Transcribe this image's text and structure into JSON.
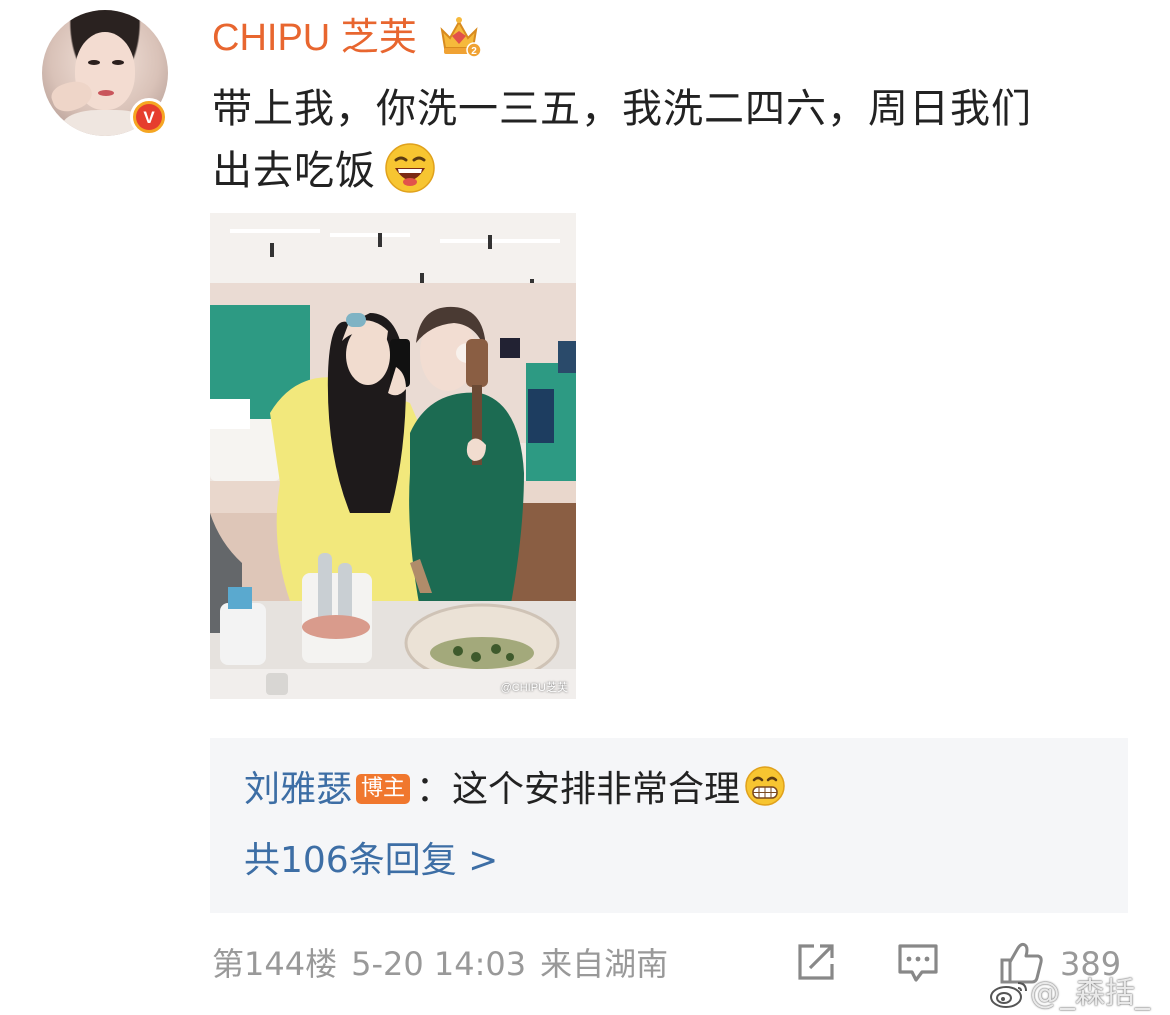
{
  "post": {
    "username": "CHIPU 芝芙",
    "verified_badge": "V",
    "text_line1": "带上我，你洗一三五，我洗二四六，周日我们",
    "text_line2": "出去吃饭",
    "photo_watermark": "@CHIPU芝芙"
  },
  "reply": {
    "author": "刘雅瑟",
    "author_tag": "博主",
    "colon": "：",
    "text": "这个安排非常合理",
    "count_text": "共106条回复 >"
  },
  "footer": {
    "floor": "第144楼",
    "time": "5-20 14:03",
    "location": "来自湖南",
    "like_count": "389"
  },
  "watermark": {
    "text": "@_森括_"
  },
  "colors": {
    "username": "#e8662f",
    "link_blue": "#3d6ea5",
    "meta_gray": "#999999",
    "reply_bg": "#f5f6f8",
    "blogger_tag": "#f0772e"
  },
  "icons": [
    "crown-level-icon",
    "laughing-emoji-icon",
    "grinning-emoji-icon",
    "share-icon",
    "comment-icon",
    "thumbs-up-icon",
    "weibo-logo-icon"
  ]
}
